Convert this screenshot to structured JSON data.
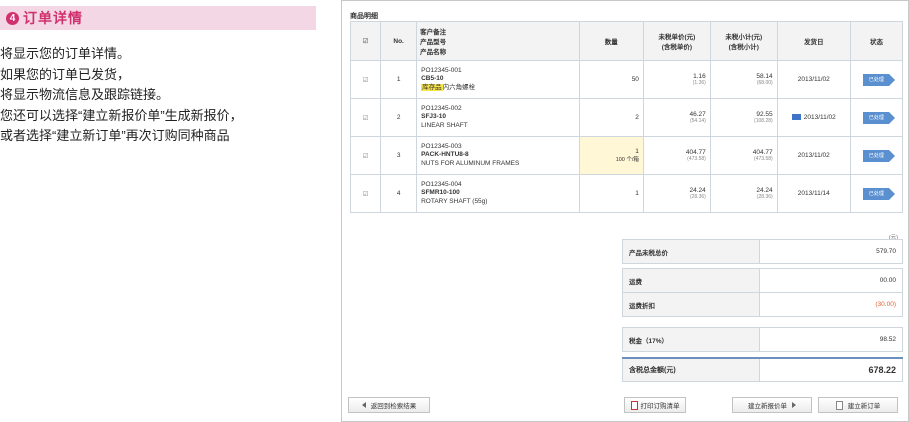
{
  "step": {
    "number": "4",
    "title": "订单详情"
  },
  "description": [
    "将显示您的订单详情。",
    "如果您的订单已发货，",
    "将显示物流信息及跟踪链接。",
    "您还可以选择“建立新报价单”生成新报价，",
    "或者选择“建立新订单”再次订购同种商品"
  ],
  "section_title": "商品明细",
  "table": {
    "headers": {
      "check": "☑",
      "no": "No.",
      "prod": [
        "客户备注",
        "产品型号",
        "产品名称"
      ],
      "qty": "数量",
      "price": [
        "未税单价(元)",
        "(含税单价)"
      ],
      "subtotal": [
        "未税小计(元)",
        "(含税小计)"
      ],
      "date": "发货日",
      "status": "状态"
    },
    "rows": [
      {
        "check": "☑",
        "no": "1",
        "po": "PO12345-001",
        "code": "CB5-10",
        "stock": "库存品",
        "name": "内六角螺栓",
        "qty": "50",
        "qty_unit": "",
        "price": "1.16",
        "price_tax": "(1.36)",
        "sub": "58.14",
        "sub_tax": "(68.00)",
        "date": "2013/11/02",
        "status": "已处理"
      },
      {
        "check": "☑",
        "no": "2",
        "po": "PO12345-002",
        "code": "SFJ3-10",
        "stock": "",
        "name": "LINEAR SHAFT",
        "qty": "2",
        "qty_unit": "",
        "price": "46.27",
        "price_tax": "(54.14)",
        "sub": "92.55",
        "sub_tax": "(108.28)",
        "date": "2013/11/02",
        "status": "已处理"
      },
      {
        "check": "☑",
        "no": "3",
        "po": "PO12345-003",
        "code": "PACK-HNTU8-8",
        "stock": "",
        "name": "NUTS FOR ALUMINUM FRAMES",
        "qty": "1",
        "qty_unit": "100 个/箱",
        "price": "404.77",
        "price_tax": "(473.58)",
        "sub": "404.77",
        "sub_tax": "(473.58)",
        "date": "2013/11/02",
        "status": "已处理"
      },
      {
        "check": "☑",
        "no": "4",
        "po": "PO12345-004",
        "code": "SFMR10-100",
        "stock": "",
        "name": "ROTARY SHAFT (55g)",
        "qty": "1",
        "qty_unit": "",
        "price": "24.24",
        "price_tax": "(28.36)",
        "sub": "24.24",
        "sub_tax": "(28.36)",
        "date": "2013/11/14",
        "status": "已处理"
      }
    ]
  },
  "currency_note": "(元)",
  "summary": {
    "untaxed_label": "产品未税总价",
    "untaxed_value": "579.70",
    "shipping_label": "运费",
    "shipping_value": "00.00",
    "shipping_discount_label": "运费折扣",
    "shipping_discount_value": "(30.00)",
    "tax_label": "税金（17%）",
    "tax_value": "98.52",
    "total_label": "含税总金额(元)",
    "total_value": "678.22"
  },
  "buttons": {
    "back": "返回到检索结果",
    "print": "打印订购清单",
    "new_quote": "建立新报价单",
    "new_order": "建立新订单"
  }
}
